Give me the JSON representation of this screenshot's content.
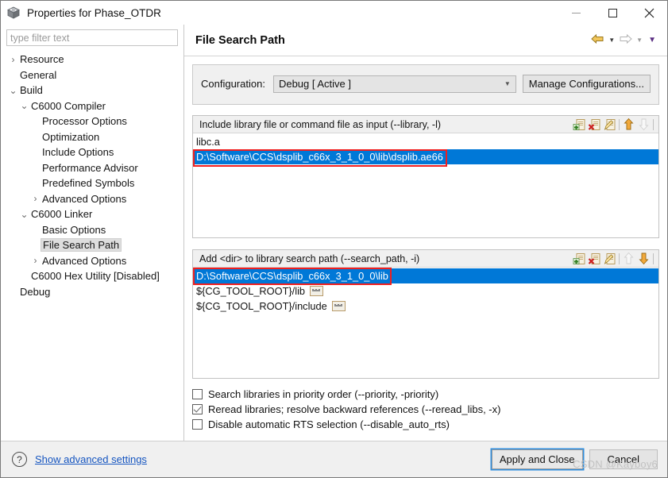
{
  "window": {
    "title": "Properties for Phase_OTDR",
    "icon": "cube-icon",
    "buttons": {
      "minimize": "minimize-icon",
      "maximize": "maximize-icon",
      "close": "close-icon"
    }
  },
  "sidebar": {
    "filter": {
      "value": "",
      "placeholder": "type filter text"
    },
    "items": [
      {
        "label": "Resource",
        "indent": 0,
        "twisty": "collapsed",
        "selected": false
      },
      {
        "label": "General",
        "indent": 0,
        "twisty": "none",
        "selected": false
      },
      {
        "label": "Build",
        "indent": 0,
        "twisty": "expanded",
        "selected": false
      },
      {
        "label": "C6000 Compiler",
        "indent": 1,
        "twisty": "expanded",
        "selected": false
      },
      {
        "label": "Processor Options",
        "indent": 2,
        "twisty": "none",
        "selected": false
      },
      {
        "label": "Optimization",
        "indent": 2,
        "twisty": "none",
        "selected": false
      },
      {
        "label": "Include Options",
        "indent": 2,
        "twisty": "none",
        "selected": false
      },
      {
        "label": "Performance Advisor",
        "indent": 2,
        "twisty": "none",
        "selected": false
      },
      {
        "label": "Predefined Symbols",
        "indent": 2,
        "twisty": "none",
        "selected": false
      },
      {
        "label": "Advanced Options",
        "indent": 2,
        "twisty": "collapsed",
        "selected": false
      },
      {
        "label": "C6000 Linker",
        "indent": 1,
        "twisty": "expanded",
        "selected": false
      },
      {
        "label": "Basic Options",
        "indent": 2,
        "twisty": "none",
        "selected": false
      },
      {
        "label": "File Search Path",
        "indent": 2,
        "twisty": "none",
        "selected": true
      },
      {
        "label": "Advanced Options",
        "indent": 2,
        "twisty": "collapsed",
        "selected": false
      },
      {
        "label": "C6000 Hex Utility  [Disabled]",
        "indent": 1,
        "twisty": "none",
        "selected": false
      },
      {
        "label": "Debug",
        "indent": 0,
        "twisty": "none",
        "selected": false
      }
    ]
  },
  "main": {
    "page_title": "File Search Path",
    "nav": {
      "back_icon": "back-arrow-icon",
      "back_menu_icon": "chevron-down-icon",
      "forward_icon": "forward-arrow-icon",
      "forward_menu_icon": "chevron-down-icon",
      "view_menu_icon": "chevron-down-icon"
    },
    "configuration": {
      "label": "Configuration:",
      "value": "Debug  [ Active ]",
      "caret_icon": "chevron-down-icon",
      "manage_button": "Manage Configurations..."
    },
    "groups": [
      {
        "title": "Include library file or command file as input (--library, -l)",
        "toolbar": [
          {
            "name": "add-icon",
            "enabled": true
          },
          {
            "name": "delete-icon",
            "enabled": true
          },
          {
            "name": "edit-icon",
            "enabled": true
          },
          {
            "name": "move-up-icon",
            "enabled": true
          },
          {
            "name": "move-down-icon",
            "enabled": false
          }
        ],
        "rows": [
          {
            "text": "libc.a",
            "selected": false,
            "badge": false
          },
          {
            "text": "D:\\Software\\CCS\\dsplib_c66x_3_1_0_0\\lib\\dsplib.ae66",
            "selected": true,
            "badge": false
          }
        ]
      },
      {
        "title": "Add <dir> to library search path (--search_path, -i)",
        "toolbar": [
          {
            "name": "add-icon",
            "enabled": true
          },
          {
            "name": "delete-icon",
            "enabled": true
          },
          {
            "name": "edit-icon",
            "enabled": true
          },
          {
            "name": "move-up-icon",
            "enabled": false
          },
          {
            "name": "move-down-icon",
            "enabled": true
          }
        ],
        "rows": [
          {
            "text": "D:\\Software\\CCS\\dsplib_c66x_3_1_0_0\\lib",
            "selected": true,
            "badge": false
          },
          {
            "text": "${CG_TOOL_ROOT}/lib",
            "selected": false,
            "badge": true
          },
          {
            "text": "${CG_TOOL_ROOT}/include",
            "selected": false,
            "badge": true
          }
        ]
      }
    ],
    "checkboxes": [
      {
        "label": "Search libraries in priority order (--priority, -priority)",
        "checked": false
      },
      {
        "label": "Reread libraries; resolve backward references (--reread_libs, -x)",
        "checked": true
      },
      {
        "label": "Disable automatic RTS selection (--disable_auto_rts)",
        "checked": false
      }
    ]
  },
  "footer": {
    "help_icon": "help-icon",
    "advanced_link": "Show advanced settings",
    "apply_button": "Apply and Close",
    "cancel_button": "Cancel"
  },
  "watermark": "CSDN @Kayboy6",
  "colors": {
    "selection_blue": "#0078d7",
    "annotation_red": "#f01f1f",
    "link_blue": "#1555c0",
    "panel_gray": "#f0f0f0"
  }
}
